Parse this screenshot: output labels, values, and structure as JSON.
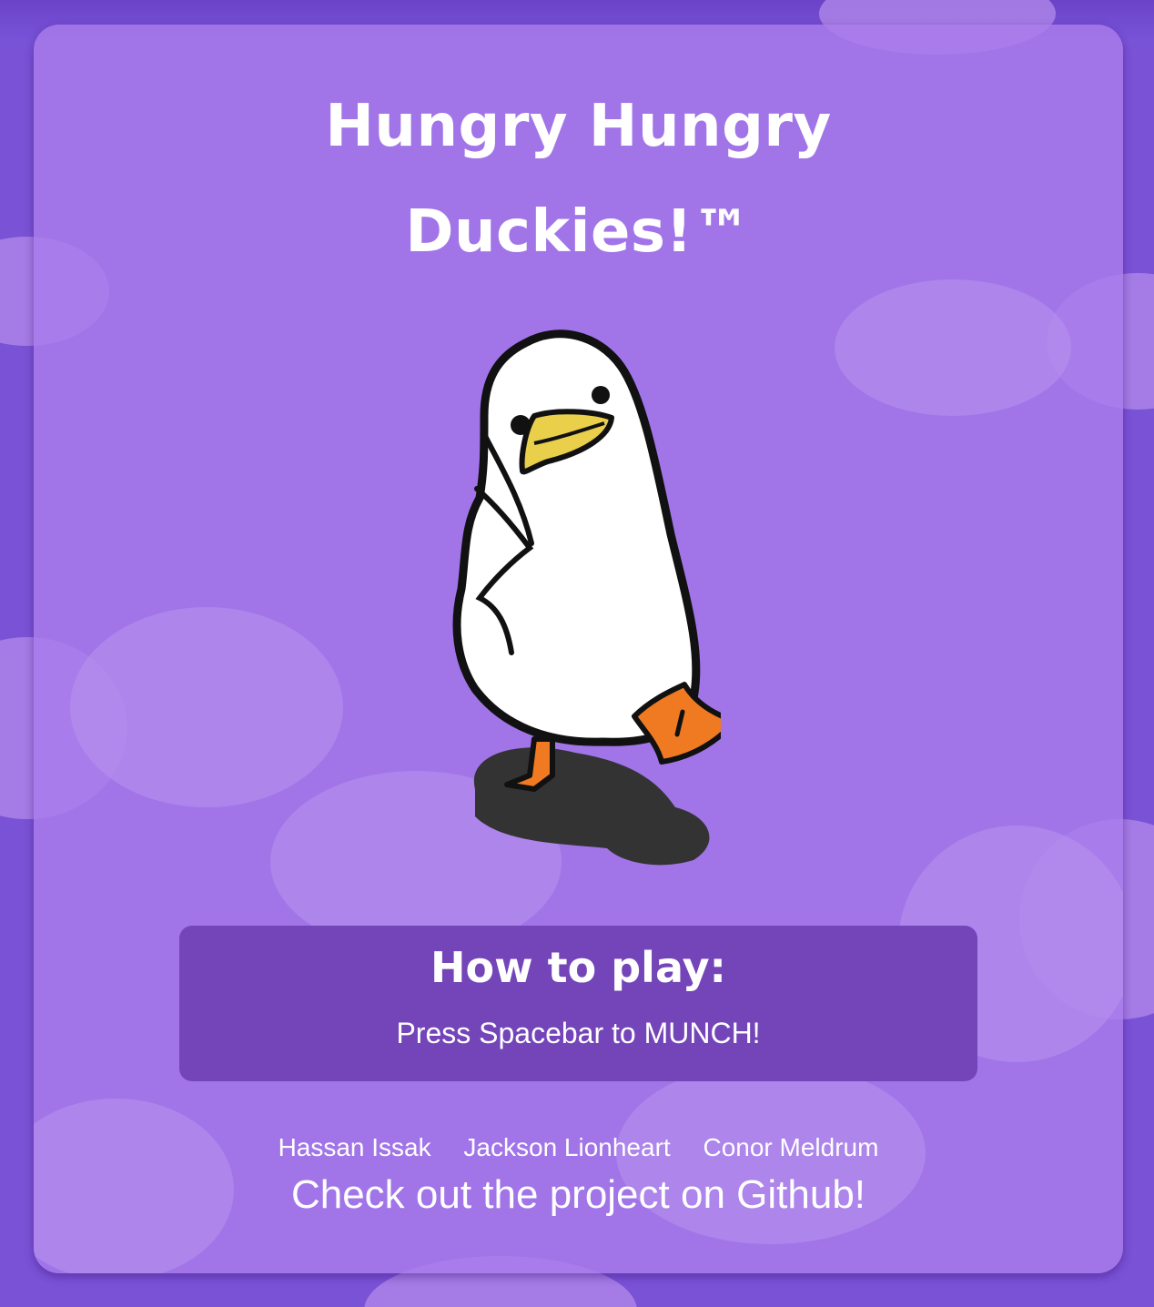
{
  "title": {
    "line1": "Hungry Hungry",
    "line2": "Duckies!™"
  },
  "duck": {
    "icon": "duck-character",
    "colors": {
      "body": "#ffffff",
      "outline": "#111111",
      "beak": "#e9cf4a",
      "feet": "#f07a22",
      "shadow": "#333333"
    }
  },
  "how_to_play": {
    "heading": "How to play:",
    "instruction": "Press Spacebar to MUNCH!"
  },
  "credits": {
    "authors": [
      "Hassan Issak",
      "Jackson Lionheart",
      "Conor Meldrum"
    ],
    "github_link": "Check out the project on Github!"
  },
  "colors": {
    "page_bg": "#7a52d6",
    "card_bg": "#a97ce8",
    "panel_bg": "#7445b8",
    "text": "#ffffff"
  }
}
